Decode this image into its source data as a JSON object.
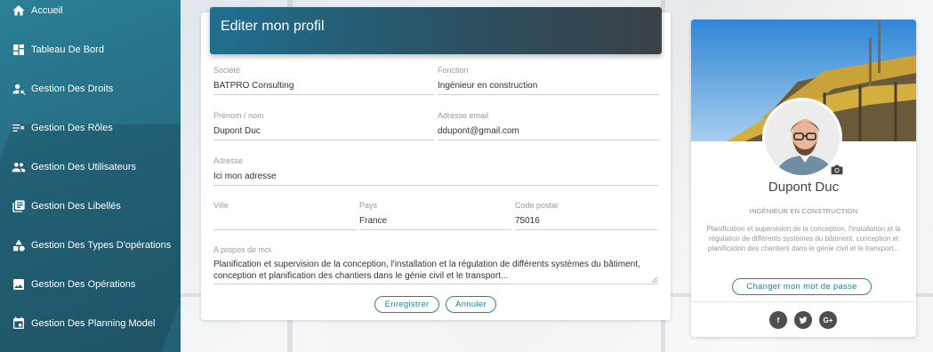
{
  "sidebar": {
    "items": [
      {
        "label": "Accueil",
        "icon": "home-icon"
      },
      {
        "label": "Tableau De Bord",
        "icon": "dashboard-icon"
      },
      {
        "label": "Gestion Des Droits",
        "icon": "user-key-icon"
      },
      {
        "label": "Gestion Des Rôles",
        "icon": "list-check-icon"
      },
      {
        "label": "Gestion Des Utilisateurs",
        "icon": "users-icon"
      },
      {
        "label": "Gestion Des Libellés",
        "icon": "library-icon"
      },
      {
        "label": "Gestion Des Types D'opérations",
        "icon": "shapes-icon"
      },
      {
        "label": "Gestion Des Opérations",
        "icon": "image-icon"
      },
      {
        "label": "Gestion Des Planning Model",
        "icon": "calendar-icon"
      }
    ]
  },
  "form": {
    "title": "Editer mon profil",
    "societe": {
      "label": "Société",
      "value": "BATPRO Consulting"
    },
    "fonction": {
      "label": "Fonction",
      "value": "Ingénieur en construction"
    },
    "prenom_nom": {
      "label": "Prénom / nom",
      "value": "Dupont Duc"
    },
    "email": {
      "label": "Adresse email",
      "value": "ddupont@gmail.com"
    },
    "adresse": {
      "label": "Adresse",
      "value": "Ici mon adresse"
    },
    "ville": {
      "label": "Ville",
      "value": ""
    },
    "pays": {
      "label": "Pays",
      "value": "France"
    },
    "code_postal": {
      "label": "Code postal",
      "value": "75016"
    },
    "apropos": {
      "label": "A propos de moi",
      "value": "Planification et supervision de la conception, l'installation et la régulation de différents systèmes du bâtiment, conception et planification des chantiers dans le génie civil et le transport..."
    },
    "save_label": "Enregistrer",
    "cancel_label": "Annuler"
  },
  "profile": {
    "name": "Dupont Duc",
    "role": "INGÉNIEUR EN CONSTRUCTION",
    "description": "Planification et supervision de la conception, l'installation et la régulation de différents systèmes du bâtiment, conception et planification des chantiers dans le génie civil et le transport...",
    "change_password_label": "Changer mon mot de passe",
    "social": [
      {
        "icon": "facebook-icon",
        "glyph": "f"
      },
      {
        "icon": "twitter-icon",
        "glyph": "t"
      },
      {
        "icon": "google-plus-icon",
        "glyph": "G+"
      }
    ]
  },
  "colors": {
    "accent": "#2a7f96",
    "header_gradient_start": "#1f6f8f",
    "header_gradient_end": "#3b4248"
  }
}
